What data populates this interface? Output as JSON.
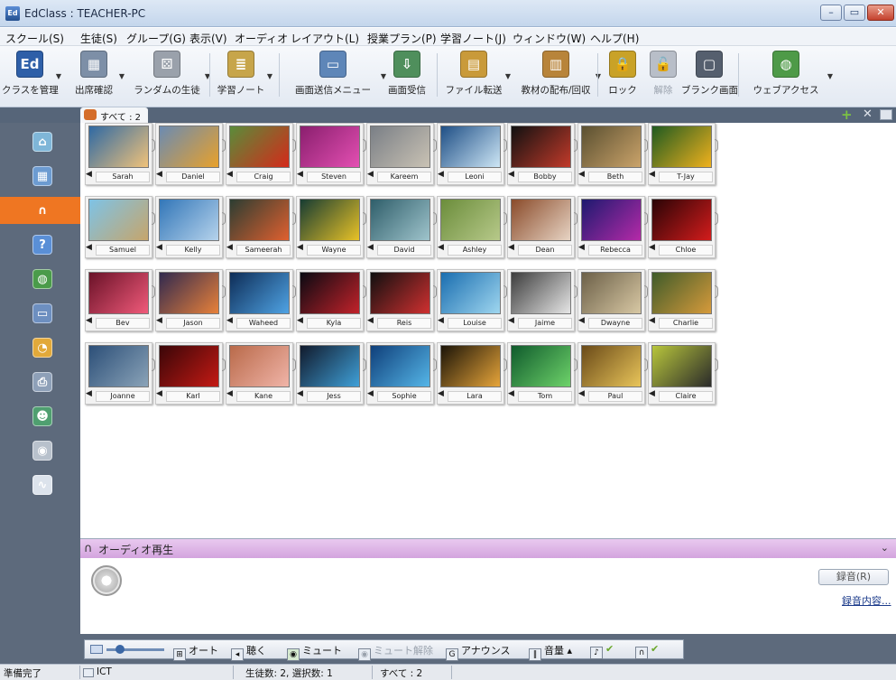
{
  "window": {
    "title": "EdClass : TEACHER-PC",
    "app_icon_label": "Ed"
  },
  "menu": [
    "スクール(S)",
    "生徒(S)",
    "グループ(G)",
    "表示(V)",
    "オーディオ",
    "レイアウト(L)",
    "授業プラン(P)",
    "学習ノート(J)",
    "ウィンドウ(W)",
    "ヘルプ(H)"
  ],
  "toolbar": [
    {
      "label": "クラスを管理",
      "icon": "edclass-logo-icon",
      "color": "#2e5fa8",
      "glyph": "Ed",
      "dropdown": true
    },
    {
      "label": "出席確認",
      "icon": "attendance-icon",
      "color": "#7d8fa7",
      "glyph": "▦",
      "dropdown": true
    },
    {
      "label": "ランダムの生徒",
      "icon": "dice-icon",
      "color": "#9aa1ab",
      "glyph": "⚄",
      "dropdown": true
    },
    {
      "label": "学習ノート",
      "icon": "notebook-icon",
      "color": "#c7a54a",
      "glyph": "≣",
      "dropdown": true
    },
    {
      "label": "画面送信メニュー",
      "icon": "screen-send-icon",
      "color": "#5e86b8",
      "glyph": "▭",
      "dropdown": true
    },
    {
      "label": "画面受信",
      "icon": "screen-receive-icon",
      "color": "#4f8f5c",
      "glyph": "⇩",
      "dropdown": false
    },
    {
      "label": "ファイル転送",
      "icon": "folder-transfer-icon",
      "color": "#c99a3a",
      "glyph": "▤",
      "dropdown": true
    },
    {
      "label": "教材の配布/回収",
      "icon": "materials-icon",
      "color": "#b8843a",
      "glyph": "▥",
      "dropdown": true
    },
    {
      "label": "ロック",
      "icon": "lock-icon",
      "color": "#c9a227",
      "glyph": "🔒",
      "dropdown": false
    },
    {
      "label": "解除",
      "icon": "unlock-icon",
      "color": "#b8bec8",
      "glyph": "🔓",
      "dropdown": false,
      "disabled": true
    },
    {
      "label": "ブランク画面",
      "icon": "blank-screen-icon",
      "color": "#555f6e",
      "glyph": "▢",
      "dropdown": false
    },
    {
      "label": "ウェブアクセス",
      "icon": "web-access-icon",
      "color": "#4e9a48",
      "glyph": "◍",
      "dropdown": true
    }
  ],
  "tab": {
    "label": "すべて : 2"
  },
  "sidebar": [
    {
      "icon": "home-icon",
      "color": "#7fb6d8",
      "glyph": "⌂",
      "active": false
    },
    {
      "icon": "thumbnail-view-icon",
      "color": "#6c9bd1",
      "glyph": "▦",
      "active": false
    },
    {
      "icon": "headphones-icon",
      "color": "#f4f4f4",
      "glyph": "∩",
      "active": true
    },
    {
      "icon": "help-icon",
      "color": "#5a8fd6",
      "glyph": "?",
      "active": false
    },
    {
      "icon": "globe-icon",
      "color": "#4a9b4a",
      "glyph": "◍",
      "active": false
    },
    {
      "icon": "window-icon",
      "color": "#6d8fc0",
      "glyph": "▭",
      "active": false
    },
    {
      "icon": "pie-chart-icon",
      "color": "#e2a93a",
      "glyph": "◔",
      "active": false
    },
    {
      "icon": "printer-icon",
      "color": "#8ea0b8",
      "glyph": "⎙",
      "active": false
    },
    {
      "icon": "users-icon",
      "color": "#4f9f70",
      "glyph": "☻",
      "active": false
    },
    {
      "icon": "disc-icon",
      "color": "#b8c1cc",
      "glyph": "◉",
      "active": false
    },
    {
      "icon": "monitor-icon",
      "color": "#dce3ec",
      "glyph": "∿",
      "active": false
    }
  ],
  "students": [
    {
      "name": "Sarah",
      "colors": [
        "#2f69a3",
        "#f0c27a"
      ]
    },
    {
      "name": "Daniel",
      "colors": [
        "#6b8bb2",
        "#e8a12b"
      ]
    },
    {
      "name": "Craig",
      "colors": [
        "#5a8c3a",
        "#d42a1a"
      ]
    },
    {
      "name": "Steven",
      "colors": [
        "#8a1f6e",
        "#e34fb2"
      ]
    },
    {
      "name": "Kareem",
      "colors": [
        "#7a7f86",
        "#c9c2b4"
      ]
    },
    {
      "name": "Leoni",
      "colors": [
        "#1f4f86",
        "#cde6f5"
      ]
    },
    {
      "name": "Bobby",
      "colors": [
        "#111111",
        "#c23a2a"
      ]
    },
    {
      "name": "Beth",
      "colors": [
        "#5b5031",
        "#caa36a"
      ]
    },
    {
      "name": "T-Jay",
      "colors": [
        "#1f5a20",
        "#f0b11e"
      ]
    },
    {
      "name": "Samuel",
      "colors": [
        "#7ec3e6",
        "#c6a56b"
      ]
    },
    {
      "name": "Kelly",
      "colors": [
        "#3276b8",
        "#b6d3ec"
      ]
    },
    {
      "name": "Sameerah",
      "colors": [
        "#2c3d32",
        "#e0602f"
      ]
    },
    {
      "name": "Wayne",
      "colors": [
        "#173c33",
        "#e8c227"
      ]
    },
    {
      "name": "David",
      "colors": [
        "#2f5e6a",
        "#9fc4cc"
      ]
    },
    {
      "name": "Ashley",
      "colors": [
        "#6b8d3b",
        "#b7c98a"
      ]
    },
    {
      "name": "Dean",
      "colors": [
        "#8a4b2a",
        "#e7d4c4"
      ]
    },
    {
      "name": "Rebecca",
      "colors": [
        "#1d1a6f",
        "#b52aa8"
      ]
    },
    {
      "name": "Chloe",
      "colors": [
        "#2a0406",
        "#d31c1c"
      ]
    },
    {
      "name": "Bev",
      "colors": [
        "#6a1228",
        "#f05a7a"
      ]
    },
    {
      "name": "Jason",
      "colors": [
        "#31294f",
        "#e8813a"
      ]
    },
    {
      "name": "Waheed",
      "colors": [
        "#0e2d57",
        "#4fa3e4"
      ]
    },
    {
      "name": "Kyla",
      "colors": [
        "#0a0a12",
        "#c2222a"
      ]
    },
    {
      "name": "Reis",
      "colors": [
        "#101010",
        "#d03030"
      ]
    },
    {
      "name": "Louise",
      "colors": [
        "#1a6eb0",
        "#9fd6ef"
      ]
    },
    {
      "name": "Jaime",
      "colors": [
        "#3d3d3d",
        "#e6e6e6"
      ]
    },
    {
      "name": "Dwayne",
      "colors": [
        "#6c6048",
        "#d8c8a4"
      ]
    },
    {
      "name": "Charlie",
      "colors": [
        "#3f5b2a",
        "#d69a3b"
      ]
    },
    {
      "name": "Joanne",
      "colors": [
        "#2c4f78",
        "#8aa3b8"
      ]
    },
    {
      "name": "Karl",
      "colors": [
        "#3a0608",
        "#c41a14"
      ]
    },
    {
      "name": "Kane",
      "colors": [
        "#b96a4a",
        "#f0b4a8"
      ]
    },
    {
      "name": "Jess",
      "colors": [
        "#111a2c",
        "#3fa0d8"
      ]
    },
    {
      "name": "Sophie",
      "colors": [
        "#0f3f7a",
        "#55b6e8"
      ]
    },
    {
      "name": "Lara",
      "colors": [
        "#1b1408",
        "#e7a53a"
      ]
    },
    {
      "name": "Tom",
      "colors": [
        "#0f5a2c",
        "#6ed36a"
      ]
    },
    {
      "name": "Paul",
      "colors": [
        "#6a4a18",
        "#e9c55a"
      ]
    },
    {
      "name": "Claire",
      "colors": [
        "#b8c63c",
        "#2a2a2a"
      ]
    }
  ],
  "audio": {
    "title": "オーディオ再生",
    "record_button": "録音(R)",
    "recordings_link": "録音内容..."
  },
  "bottom_toolbar": {
    "auto": "オート",
    "listen": "聴く",
    "mute": "ミュート",
    "unmute": "ミュート解除",
    "announce": "アナウンス",
    "volume": "音量"
  },
  "status": {
    "ready": "準備完了",
    "computer": "ICT",
    "counts": "生徒数: 2, 選択数: 1",
    "filter": "すべて : 2"
  }
}
